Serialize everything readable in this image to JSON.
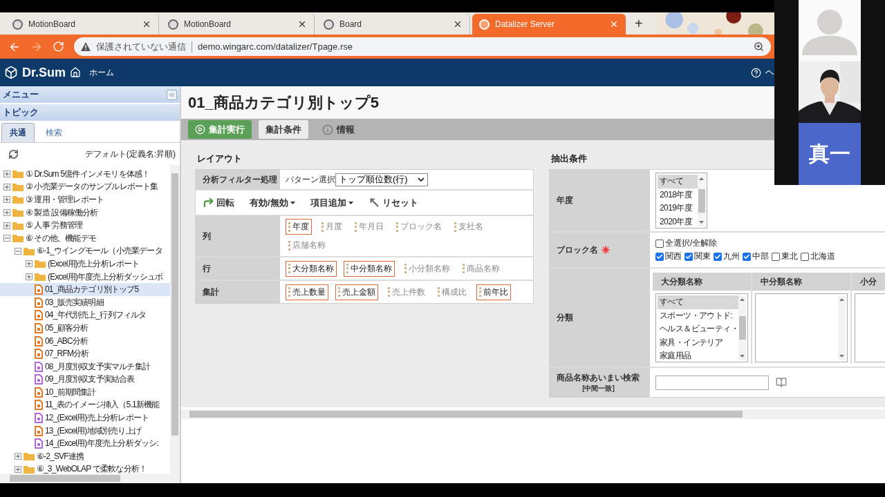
{
  "browser": {
    "tabs": [
      {
        "title": "MotionBoard",
        "selected": false
      },
      {
        "title": "MotionBoard",
        "selected": false
      },
      {
        "title": "Board",
        "selected": false
      },
      {
        "title": "Datalizer Server",
        "selected": true
      }
    ],
    "new_tab": "+",
    "security_warning": "保護されていない通信",
    "url": "demo.wingarc.com/datalizer/Tpage.rse"
  },
  "header": {
    "logo": "Dr.Sum",
    "home": "ホーム",
    "help": "ヘ"
  },
  "sidebar": {
    "menu_title": "メニュー",
    "topic_title": "トピック",
    "tabs": [
      {
        "label": "共通",
        "selected": true
      },
      {
        "label": "検索",
        "selected": false
      }
    ],
    "sort_label": "デフォルト(定義名:昇順)",
    "tree": [
      {
        "label": "① Dr.Sum 5億件インメモリを体感！",
        "kind": "folder",
        "expanded": false,
        "selected": false
      },
      {
        "label": "② 小売業データのサンプルレポート集",
        "kind": "folder",
        "expanded": false,
        "selected": false
      },
      {
        "label": "③ 運用・管理レポート",
        "kind": "folder",
        "expanded": false,
        "selected": false
      },
      {
        "label": "④ 製造 設備稼働分析",
        "kind": "folder",
        "expanded": false,
        "selected": false
      },
      {
        "label": "⑤ 人事 労務管理",
        "kind": "folder",
        "expanded": false,
        "selected": false
      },
      {
        "label": "⑥ その他、機能デモ",
        "kind": "folder",
        "expanded": true,
        "selected": false,
        "children": [
          {
            "label": "⑥-1_ウイングモール（小売業データ",
            "kind": "folder",
            "expanded": true,
            "selected": false,
            "children": [
              {
                "label": "(Excel用)売上分析レポート",
                "kind": "folder",
                "expanded": false,
                "selected": false
              },
              {
                "label": "(Excel用)年度売上分析ダッシュボ",
                "kind": "folder",
                "expanded": false,
                "selected": false
              },
              {
                "label": "01_商品カテゴリ別トップ5",
                "kind": "doc",
                "color": "#e07b2a",
                "selected": true
              },
              {
                "label": "03_販売実績明細",
                "kind": "doc",
                "color": "#e07b2a",
                "selected": false
              },
              {
                "label": "04_年代別売上_行列フィルタ",
                "kind": "doc",
                "color": "#e07b2a",
                "selected": false
              },
              {
                "label": "05_顧客分析",
                "kind": "doc",
                "color": "#e07b2a",
                "selected": false
              },
              {
                "label": "06_ABC分析",
                "kind": "doc",
                "color": "#e07b2a",
                "selected": false
              },
              {
                "label": "07_RFM分析",
                "kind": "doc",
                "color": "#e07b2a",
                "selected": false
              },
              {
                "label": "08_月度別収支予実マルチ集計",
                "kind": "doc",
                "color": "#b36cd6",
                "selected": false
              },
              {
                "label": "09_月度別収支予実結合表",
                "kind": "doc",
                "color": "#b36cd6",
                "selected": false
              },
              {
                "label": "10_前期間集計",
                "kind": "doc",
                "color": "#e07b2a",
                "selected": false
              },
              {
                "label": "11_表のイメージ挿入（5.1新機能",
                "kind": "doc",
                "color": "#e07b2a",
                "selected": false
              },
              {
                "label": "12_(Excel用)売上分析レポート",
                "kind": "doc",
                "color": "#b36cd6",
                "selected": false
              },
              {
                "label": "13_(Excel用)地域別売り上げ",
                "kind": "doc",
                "color": "#e07b2a",
                "selected": false
              },
              {
                "label": "14_(Excel用)年度売上分析ダッシ:",
                "kind": "doc",
                "color": "#b36cd6",
                "selected": false
              }
            ]
          },
          {
            "label": "⑥-2_SVF連携",
            "kind": "folder",
            "expanded": false,
            "selected": false
          },
          {
            "label": "⑥_3_WebOLAP で柔軟な分析！",
            "kind": "folder",
            "expanded": false,
            "selected": false
          }
        ]
      }
    ]
  },
  "report": {
    "title": "01_商品カテゴリ別トップ5",
    "toolbar": [
      {
        "label": "集計実行",
        "kind": "run"
      },
      {
        "label": "集計条件",
        "kind": "plain"
      },
      {
        "label": "情報",
        "kind": "info"
      }
    ],
    "layout": {
      "title": "レイアウト",
      "filter_label": "分析フィルター処理",
      "pattern_label": "パターン選択",
      "pattern_value": "トップ順位数(行)",
      "actions": [
        {
          "label": "回転",
          "kind": "rotate"
        },
        {
          "label": "有効/無効",
          "kind": "dropdown"
        },
        {
          "label": "項目追加",
          "kind": "dropdown"
        },
        {
          "label": "リセット",
          "kind": "reset"
        }
      ],
      "sections": [
        {
          "label": "列",
          "fields": [
            {
              "label": "年度",
              "selected": true
            },
            {
              "label": "月度",
              "selected": false
            },
            {
              "label": "年月日",
              "selected": false
            },
            {
              "label": "ブロック名",
              "selected": false
            },
            {
              "label": "支社名",
              "selected": false
            },
            {
              "label": "店舗名称",
              "selected": false
            }
          ]
        },
        {
          "label": "行",
          "fields": [
            {
              "label": "大分類名称",
              "selected": true
            },
            {
              "label": "中分類名称",
              "selected": true
            },
            {
              "label": "小分類名称",
              "selected": false
            },
            {
              "label": "商品名称",
              "selected": false
            }
          ]
        },
        {
          "label": "集計",
          "fields": [
            {
              "label": "売上数量",
              "selected": true
            },
            {
              "label": "売上金額",
              "selected": true
            },
            {
              "label": "売上件数",
              "selected": false
            },
            {
              "label": "構成比",
              "selected": false
            },
            {
              "label": "前年比",
              "selected": true
            }
          ]
        }
      ]
    },
    "conditions": {
      "title": "抽出条件",
      "year": {
        "label": "年度",
        "options": [
          {
            "label": "すべて",
            "selected": true
          },
          {
            "label": "2018年度",
            "selected": false
          },
          {
            "label": "2019年度",
            "selected": false
          },
          {
            "label": "2020年度",
            "selected": false
          }
        ]
      },
      "block": {
        "label": "ブロック名",
        "required": true,
        "select_all": {
          "label": "全選択/全解除",
          "checked": false
        },
        "options": [
          {
            "label": "関西",
            "checked": true
          },
          {
            "label": "関東",
            "checked": true
          },
          {
            "label": "九州",
            "checked": true
          },
          {
            "label": "中部",
            "checked": true
          },
          {
            "label": "東北",
            "checked": false
          },
          {
            "label": "北海道",
            "checked": false
          }
        ]
      },
      "category": {
        "label": "分類",
        "columns": [
          {
            "header": "大分類名称",
            "options": [
              {
                "label": "すべて",
                "selected": true
              },
              {
                "label": "スポーツ・アウトド:",
                "selected": false
              },
              {
                "label": "ヘルス＆ビューティ・",
                "selected": false
              },
              {
                "label": "家具・インテリア",
                "selected": false
              },
              {
                "label": "家庭用品",
                "selected": false
              }
            ]
          },
          {
            "header": "中分類名称"
          },
          {
            "header": "小分"
          }
        ]
      },
      "search": {
        "label": "商品名称あいまい検索",
        "note": "[中間一致]"
      }
    }
  },
  "video_call": {
    "name_tile": "真一"
  }
}
